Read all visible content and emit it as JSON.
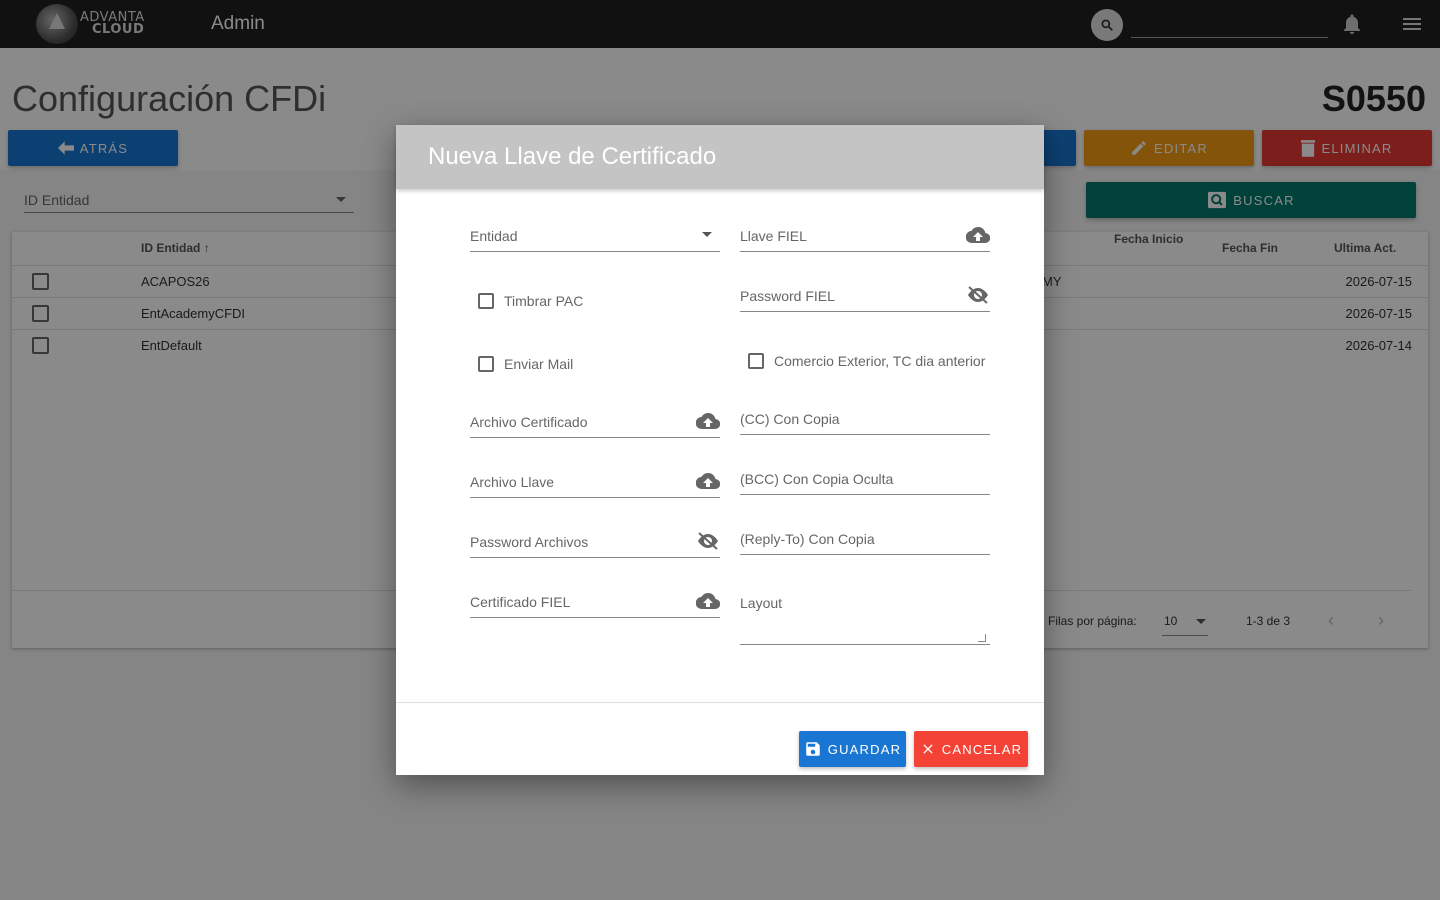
{
  "topbar": {
    "logo": {
      "line1": "ADVANTA",
      "line2": "CLOUD"
    },
    "app_title": "Admin",
    "search_placeholder": ""
  },
  "page": {
    "title": "Configuración CFDi",
    "code": "S0550",
    "buttons": {
      "back": "ATRÁS",
      "edit": "EDITAR",
      "delete": "ELIMINAR",
      "search": "BUSCAR"
    },
    "filter_label": "ID Entidad"
  },
  "table": {
    "headers": {
      "id": "ID Entidad",
      "fecha_inicio": "Fecha Inicio",
      "fecha_fin": "Fecha Fin",
      "ultima_act": "Ultima Act."
    },
    "rows": [
      {
        "id": "ACAPOS26",
        "frag": "MY",
        "date": "2026-07-15"
      },
      {
        "id": "EntAcademyCFDI",
        "frag": "",
        "date": "2026-07-15"
      },
      {
        "id": "EntDefault",
        "frag": "",
        "date": "2026-07-14"
      }
    ],
    "pager": {
      "rows_label": "Filas por página:",
      "rows_value": "10",
      "count": "1-3 de 3"
    }
  },
  "modal": {
    "title": "Nueva Llave de Certificado",
    "left": {
      "entidad": "Entidad",
      "timbrar_pac": "Timbrar PAC",
      "enviar_mail": "Enviar Mail",
      "archivo_certificado": "Archivo Certificado",
      "archivo_llave": "Archivo Llave",
      "password_archivos": "Password Archivos",
      "certificado_fiel": "Certificado FIEL"
    },
    "right": {
      "llave_fiel": "Llave FIEL",
      "password_fiel": "Password FIEL",
      "comercio_exterior": "Comercio Exterior, TC dia anterior",
      "cc": "(CC) Con Copia",
      "bcc": "(BCC) Con Copia Oculta",
      "reply_to": "(Reply-To) Con Copia",
      "layout": "Layout"
    },
    "buttons": {
      "save": "GUARDAR",
      "cancel": "CANCELAR"
    }
  },
  "colors": {
    "primary": "#1976d2",
    "warning": "#f39c12",
    "danger": "#e53935",
    "teal": "#00796b",
    "modal_header": "#c4c4c4"
  }
}
